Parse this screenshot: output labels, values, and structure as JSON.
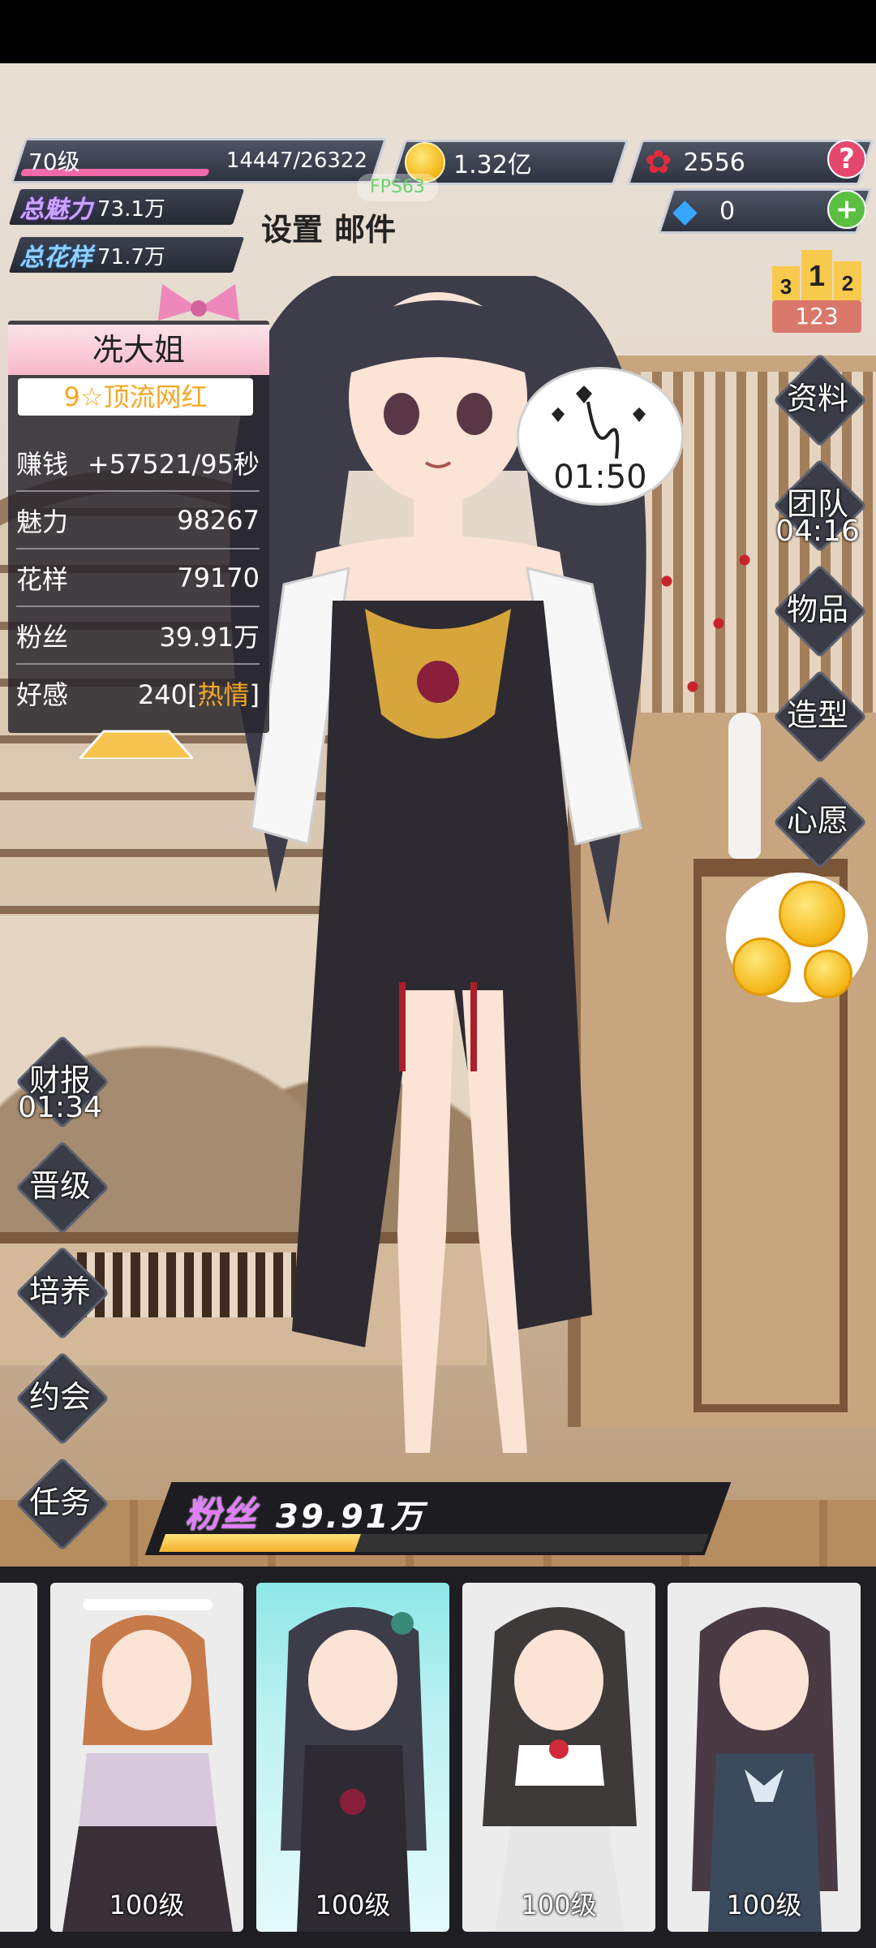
{
  "top_hud": {
    "level_label": "70级",
    "exp_text": "14447/26322",
    "exp_fraction": 0.549,
    "coins": "1.32亿",
    "roses": "2556",
    "gems": "0",
    "fps": "FPS63",
    "charm_title": "总魅力",
    "charm_value": "73.1万",
    "flair_title": "总花样",
    "flair_value": "71.7万",
    "settings_label": "设置",
    "mail_label": "邮件",
    "help_symbol": "?",
    "add_symbol": "+"
  },
  "rank": {
    "podium": [
      "3",
      "1",
      "2"
    ],
    "value": "123"
  },
  "character_info": {
    "name": "冼大姐",
    "title": "9☆顶流网红",
    "rows": [
      {
        "label": "赚钱",
        "value": "+57521/95秒"
      },
      {
        "label": "魅力",
        "value": "98267"
      },
      {
        "label": "花样",
        "value": "79170"
      },
      {
        "label": "粉丝",
        "value": "39.91万"
      }
    ],
    "affection_label": "好感",
    "affection_value": "240",
    "affection_status_open": "[",
    "affection_status": "热情",
    "affection_status_close": "]"
  },
  "right_menu": {
    "profile": "资料",
    "team": "团队",
    "team_timer": "04:16",
    "items": "物品",
    "style": "造型",
    "wish": "心愿"
  },
  "love_bubble": {
    "timer": "01:50"
  },
  "left_menu": {
    "report": "财报",
    "report_timer": "01:34",
    "promote": "晋级",
    "train": "培养",
    "date": "约会",
    "tasks": "任务"
  },
  "fans": {
    "label": "粉丝",
    "value": "39.91万",
    "progress_fraction": 0.36
  },
  "cards": [
    {
      "level": "100级"
    },
    {
      "level": "100级"
    },
    {
      "level": "100级"
    },
    {
      "level": "100级"
    }
  ],
  "colors": {
    "accent_pink": "#f06aa9",
    "gold": "#f6a623",
    "panel_dark": "#2e3340",
    "selected_card": "#8ee7e7"
  }
}
